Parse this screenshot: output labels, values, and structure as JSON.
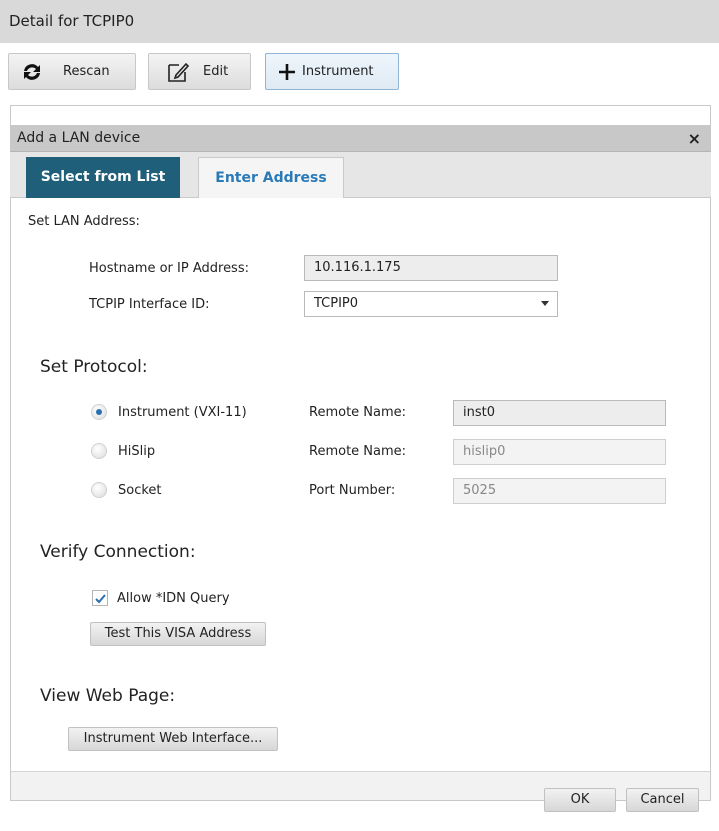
{
  "window": {
    "title": "Detail for TCPIP0"
  },
  "toolbar": {
    "rescan_label": "Rescan",
    "edit_label": "Edit",
    "instrument_label": "Instrument"
  },
  "dialog": {
    "title": "Add a LAN device",
    "close_glyph": "×",
    "tabs": [
      {
        "label": "Select from List",
        "active": true
      },
      {
        "label": "Enter Address",
        "active": false
      }
    ],
    "set_lan_address_label": "Set LAN Address:",
    "hostname_label": "Hostname or IP Address:",
    "hostname_value": "10.116.1.175",
    "interface_label": "TCPIP Interface ID:",
    "interface_value": "TCPIP0",
    "set_protocol_label": "Set Protocol:",
    "protocols": [
      {
        "label": "Instrument (VXI-11)",
        "field_label": "Remote Name:",
        "value": "inst0",
        "selected": true
      },
      {
        "label": "HiSlip",
        "field_label": "Remote Name:",
        "value": "hislip0",
        "selected": false
      },
      {
        "label": "Socket",
        "field_label": "Port Number:",
        "value": "5025",
        "selected": false
      }
    ],
    "verify_label": "Verify Connection:",
    "allow_idn_label": "Allow *IDN Query",
    "allow_idn_checked": true,
    "test_button_label": "Test This VISA Address",
    "view_web_label": "View Web Page:",
    "web_button_label": "Instrument Web Interface...",
    "ok_label": "OK",
    "cancel_label": "Cancel"
  },
  "colors": {
    "tab_active_bg": "#1f5f7a",
    "tab_inactive_text": "#2a7ab8",
    "radio_dot": "#2a6fb0"
  }
}
